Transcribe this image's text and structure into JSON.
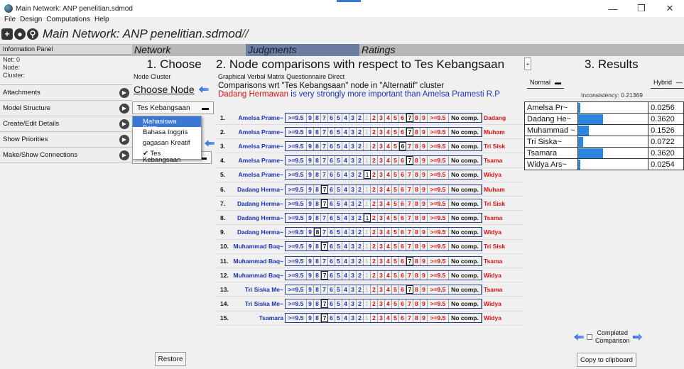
{
  "window": {
    "title": "Main Network: ANP penelitian.sdmod",
    "minimize": "—",
    "restore": "❐",
    "close": "✕"
  },
  "menu": [
    "File",
    "Design",
    "Computations",
    "Help"
  ],
  "toolbar": {
    "network_title": "Main Network: ANP penelitian.sdmod",
    "suffix": "//"
  },
  "tabs": {
    "network": "Network",
    "judgments": "Judgments",
    "ratings": "Ratings"
  },
  "info": {
    "header": "Information Panel",
    "net": "Net: 0",
    "node": "Node:",
    "cluster": "Cluster:"
  },
  "sidebar": [
    "Attachments",
    "Model Structure",
    "Create/Edit Details",
    "Show Priorities",
    "Make/Show Connections"
  ],
  "choose": {
    "header": "1. Choose",
    "subtabs": [
      "Node",
      "Cluster"
    ],
    "choose_node": "Choose Node",
    "node_select": "Tes Kebangsaan",
    "dropdown": [
      "Mahasiswa Berp~",
      "Bahasa Inggris",
      "gagasan Kreatif",
      "✔ Tes Kebangsaan"
    ],
    "restore": "Restore"
  },
  "compare": {
    "header": "2. Node comparisons with respect to Tes Kebangsaan",
    "modes": [
      "Graphical",
      "Verbal",
      "Matrix",
      "Questionnaire",
      "Direct"
    ],
    "wrt": "Comparisons wrt \"Tes Kebangsaan\" node in \"Alternatif\" cluster",
    "verbal_left": "Dadang Hermawan",
    "verbal_mid": "is very strongly more important than",
    "verbal_right": "Amelsa Pramesti R.P",
    "scale_left": [
      ">=9.5",
      "9",
      "8",
      "7",
      "6",
      "5",
      "4",
      "3",
      "2",
      "1"
    ],
    "scale_right": [
      "2",
      "3",
      "4",
      "5",
      "6",
      "7",
      "8",
      "9",
      ">=9.5"
    ],
    "no_comp": "No comp.",
    "rows": [
      {
        "num": "1.",
        "left": "Amelsa Prame~",
        "right": "Dadang",
        "sel": "R7"
      },
      {
        "num": "2.",
        "left": "Amelsa Prame~",
        "right": "Muham",
        "sel": "R7"
      },
      {
        "num": "3.",
        "left": "Amelsa Prame~",
        "right": "Tri Sisk",
        "sel": "R6"
      },
      {
        "num": "4.",
        "left": "Amelsa Prame~",
        "right": "Tsama",
        "sel": "R7"
      },
      {
        "num": "5.",
        "left": "Amelsa Prame~",
        "right": "Widya",
        "sel": "1"
      },
      {
        "num": "6.",
        "left": "Dadang Herma~",
        "right": "Muham",
        "sel": "L7"
      },
      {
        "num": "7.",
        "left": "Dadang Herma~",
        "right": "Tri Sisk",
        "sel": "L7"
      },
      {
        "num": "8.",
        "left": "Dadang Herma~",
        "right": "Tsama",
        "sel": "1"
      },
      {
        "num": "9.",
        "left": "Dadang Herma~",
        "right": "Widya",
        "sel": "L8"
      },
      {
        "num": "10.",
        "left": "Muhammad Baq~",
        "right": "Tri Sisk",
        "sel": "L7"
      },
      {
        "num": "11.",
        "left": "Muhammad Baq~",
        "right": "Tsama",
        "sel": "R7"
      },
      {
        "num": "12.",
        "left": "Muhammad Baq~",
        "right": "Widya",
        "sel": "L7"
      },
      {
        "num": "13.",
        "left": "Tri Siska Me~",
        "right": "Tsama",
        "sel": "R7"
      },
      {
        "num": "14.",
        "left": "Tri Siska Me~",
        "right": "Widya",
        "sel": "L7"
      },
      {
        "num": "15.",
        "left": "Tsamara",
        "right": "Widya",
        "sel": "L7"
      }
    ]
  },
  "results": {
    "header": "3. Results",
    "expand": "+",
    "normal": "Normal",
    "hybrid": "Hybrid",
    "inconsistency": "Inconsistency: 0.21369",
    "rows": [
      {
        "name": "Amelsa Pr~",
        "value": "0.0256",
        "fraction": 0.0256
      },
      {
        "name": "Dadang He~",
        "value": "0.3620",
        "fraction": 0.362
      },
      {
        "name": "Muhammad ~",
        "value": "0.1526",
        "fraction": 0.1526
      },
      {
        "name": "Tri Siska~",
        "value": "0.0722",
        "fraction": 0.0722
      },
      {
        "name": "Tsamara",
        "value": "0.3620",
        "fraction": 0.362
      },
      {
        "name": "Widya Ars~",
        "value": "0.0254",
        "fraction": 0.0254
      }
    ],
    "completed": "Completed",
    "comparison": "Comparison",
    "copy": "Copy to clipboard"
  }
}
